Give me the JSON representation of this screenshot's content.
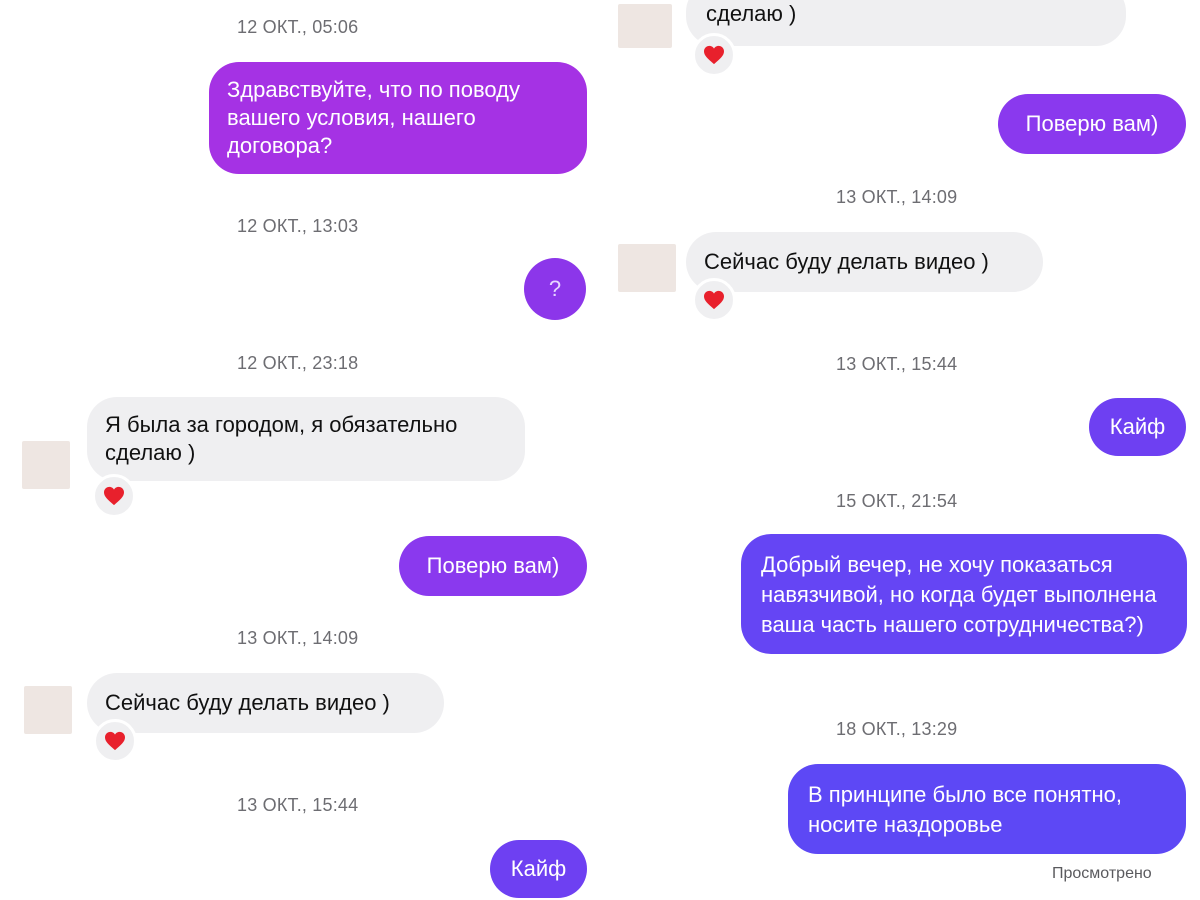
{
  "left": {
    "timestamps": [
      "12 ОКТ., 05:06",
      "12 ОКТ., 13:03",
      "12 ОКТ., 23:18",
      "13 ОКТ., 14:09",
      "13 ОКТ., 15:44"
    ],
    "messages": [
      {
        "from": "me",
        "text": "Здравствуйте, что по поводу вашего условия, нашего договора?"
      },
      {
        "from": "me",
        "text": "?"
      },
      {
        "from": "them",
        "text": "Я была за городом, я обязательно сделаю )",
        "reaction": "heart-icon"
      },
      {
        "from": "me",
        "text": "Поверю вам)"
      },
      {
        "from": "them",
        "text": "Сейчас буду делать видео )",
        "reaction": "heart-icon"
      },
      {
        "from": "me",
        "text": "Кайф"
      }
    ]
  },
  "right": {
    "timestamps": [
      "13 ОКТ., 14:09",
      "13 ОКТ., 15:44",
      "15 ОКТ., 21:54",
      "18 ОКТ., 13:29"
    ],
    "messages": [
      {
        "from": "them",
        "text": "сделаю )",
        "reaction": "heart-icon"
      },
      {
        "from": "me",
        "text": "Поверю вам)"
      },
      {
        "from": "them",
        "text": "Сейчас буду делать видео )",
        "reaction": "heart-icon"
      },
      {
        "from": "me",
        "text": "Кайф"
      },
      {
        "from": "me",
        "text": "Добрый вечер, не хочу показаться навязчивой, но когда будет выполнена ваша часть нашего сотрудничества?)"
      },
      {
        "from": "me",
        "text": "В принципе было все понятно, носите наздоровье"
      }
    ],
    "status": "Просмотрено"
  },
  "colors": {
    "outgoing_purple": "#a434e6",
    "outgoing_violet": "#7b3cf2",
    "outgoing_blue": "#6247f5",
    "incoming_bg": "#efeff1",
    "reaction_heart": "#e8202c"
  }
}
